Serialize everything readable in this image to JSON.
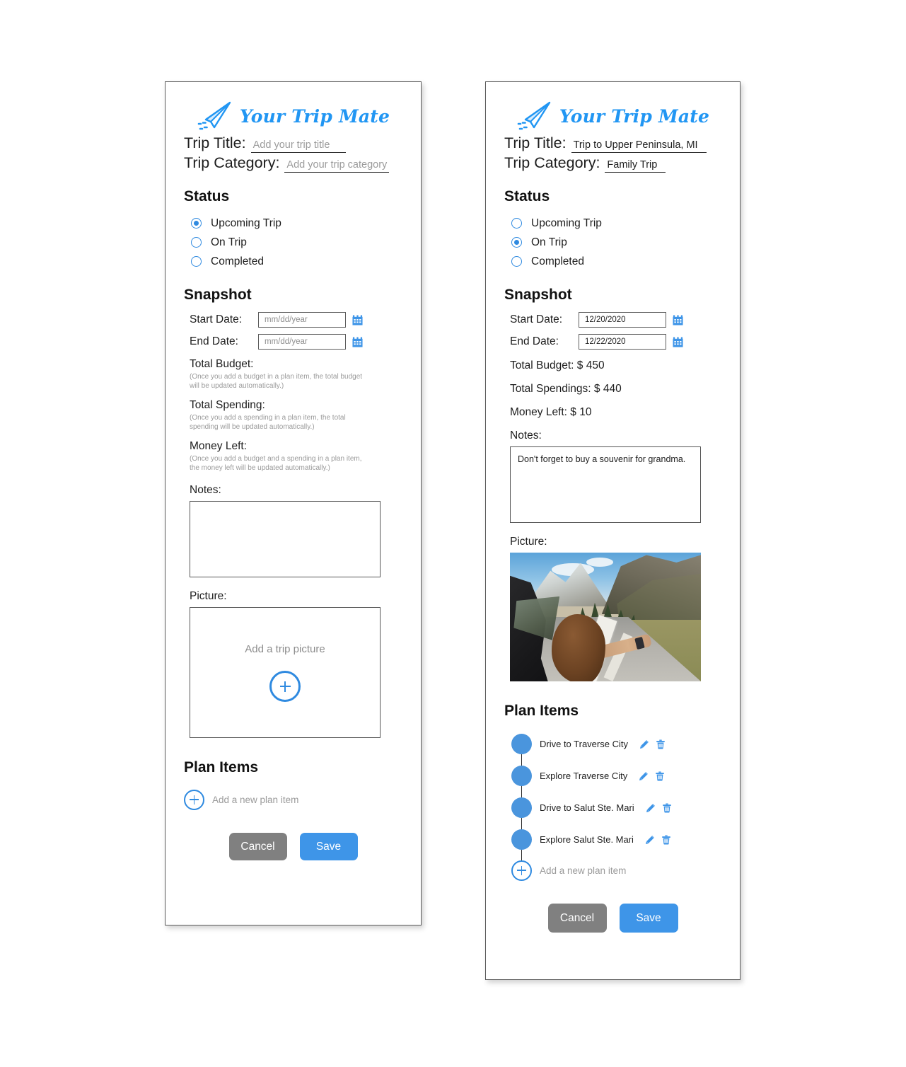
{
  "brand": {
    "name": "Your Trip Mate",
    "accent_color": "#2f8ae0",
    "plane_icon": "paper-plane-icon"
  },
  "cards": {
    "empty": {
      "trip_title_label": "Trip Title:",
      "trip_title_placeholder": "Add your trip title",
      "trip_category_label": "Trip Category:",
      "trip_category_placeholder": "Add your trip category",
      "status_heading": "Status",
      "status_options": [
        {
          "label": "Upcoming Trip",
          "selected": true
        },
        {
          "label": "On Trip",
          "selected": false
        },
        {
          "label": "Completed",
          "selected": false
        }
      ],
      "snapshot_heading": "Snapshot",
      "start_date_label": "Start Date:",
      "start_date_placeholder": "mm/dd/year",
      "end_date_label": "End Date:",
      "end_date_placeholder": "mm/dd/year",
      "total_budget_label": "Total Budget:",
      "total_budget_hint": "(Once you add a budget in a plan item, the total budget will be updated automatically.)",
      "total_spending_label": "Total Spending:",
      "total_spending_hint": "(Once you add a spending in a plan item, the total spending will be updated automatically.)",
      "money_left_label": "Money Left:",
      "money_left_hint": "(Once you add a budget and a spending in a plan item, the money left will be updated automatically.)",
      "notes_label": "Notes:",
      "notes_value": "",
      "picture_label": "Picture:",
      "picture_drop_text": "Add a trip picture",
      "plan_items_heading": "Plan Items",
      "add_plan_item_text": "Add a new plan item",
      "cancel_label": "Cancel",
      "save_label": "Save"
    },
    "filled": {
      "trip_title_label": "Trip Title:",
      "trip_title_value": "Trip to Upper Peninsula, MI",
      "trip_category_label": "Trip Category:",
      "trip_category_value": "Family Trip",
      "status_heading": "Status",
      "status_options": [
        {
          "label": "Upcoming Trip",
          "selected": false
        },
        {
          "label": "On Trip",
          "selected": true
        },
        {
          "label": "Completed",
          "selected": false
        }
      ],
      "snapshot_heading": "Snapshot",
      "start_date_label": "Start Date:",
      "start_date_value": "12/20/2020",
      "end_date_label": "End Date:",
      "end_date_value": "12/22/2020",
      "total_budget_line": "Total Budget:  $ 450",
      "total_spendings_line": "Total Spendings:   $ 440",
      "money_left_line": "Money Left: $ 10",
      "notes_label": "Notes:",
      "notes_value": "Don't forget to buy a souvenir for grandma.",
      "picture_label": "Picture:",
      "picture_alt": "road-trip-photo",
      "plan_items_heading": "Plan Items",
      "plan_items": [
        {
          "label": "Drive to Traverse City"
        },
        {
          "label": "Explore Traverse City"
        },
        {
          "label": "Drive to Salut Ste. Mari"
        },
        {
          "label": "Explore Salut Ste. Mari"
        }
      ],
      "add_plan_item_text": "Add a new plan item",
      "cancel_label": "Cancel",
      "save_label": "Save"
    }
  }
}
